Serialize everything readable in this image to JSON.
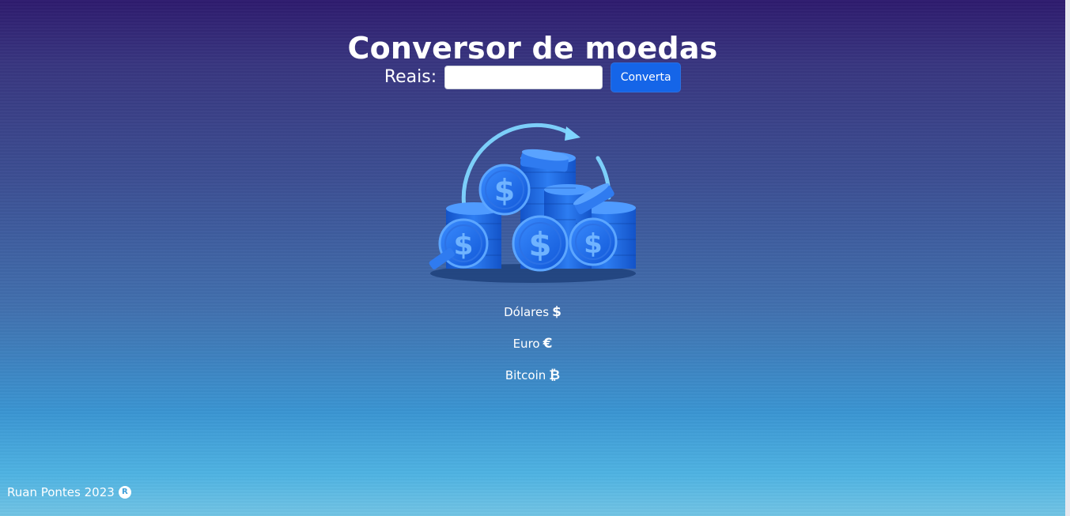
{
  "header": {
    "title": "Conversor de moedas"
  },
  "form": {
    "label": "Reais:",
    "input_value": "",
    "input_placeholder": "",
    "button_label": "Converta"
  },
  "illustration": {
    "icon": "coins-exchange-icon",
    "coin_symbol": "$"
  },
  "currencies": [
    {
      "label": "Dólares",
      "symbol": "$",
      "icon": "dollar-icon"
    },
    {
      "label": "Euro",
      "symbol": "€",
      "icon": "euro-icon"
    },
    {
      "label": "Bitcoin",
      "symbol": "₿",
      "icon": "bitcoin-icon"
    }
  ],
  "footer": {
    "text": "Ruan Pontes 2023",
    "badge": "R"
  },
  "colors": {
    "button": "#1565e8",
    "gradient_top": "#2e1b6e",
    "gradient_bottom": "#72c4e4",
    "coin_blue": "#1f6fe6"
  }
}
